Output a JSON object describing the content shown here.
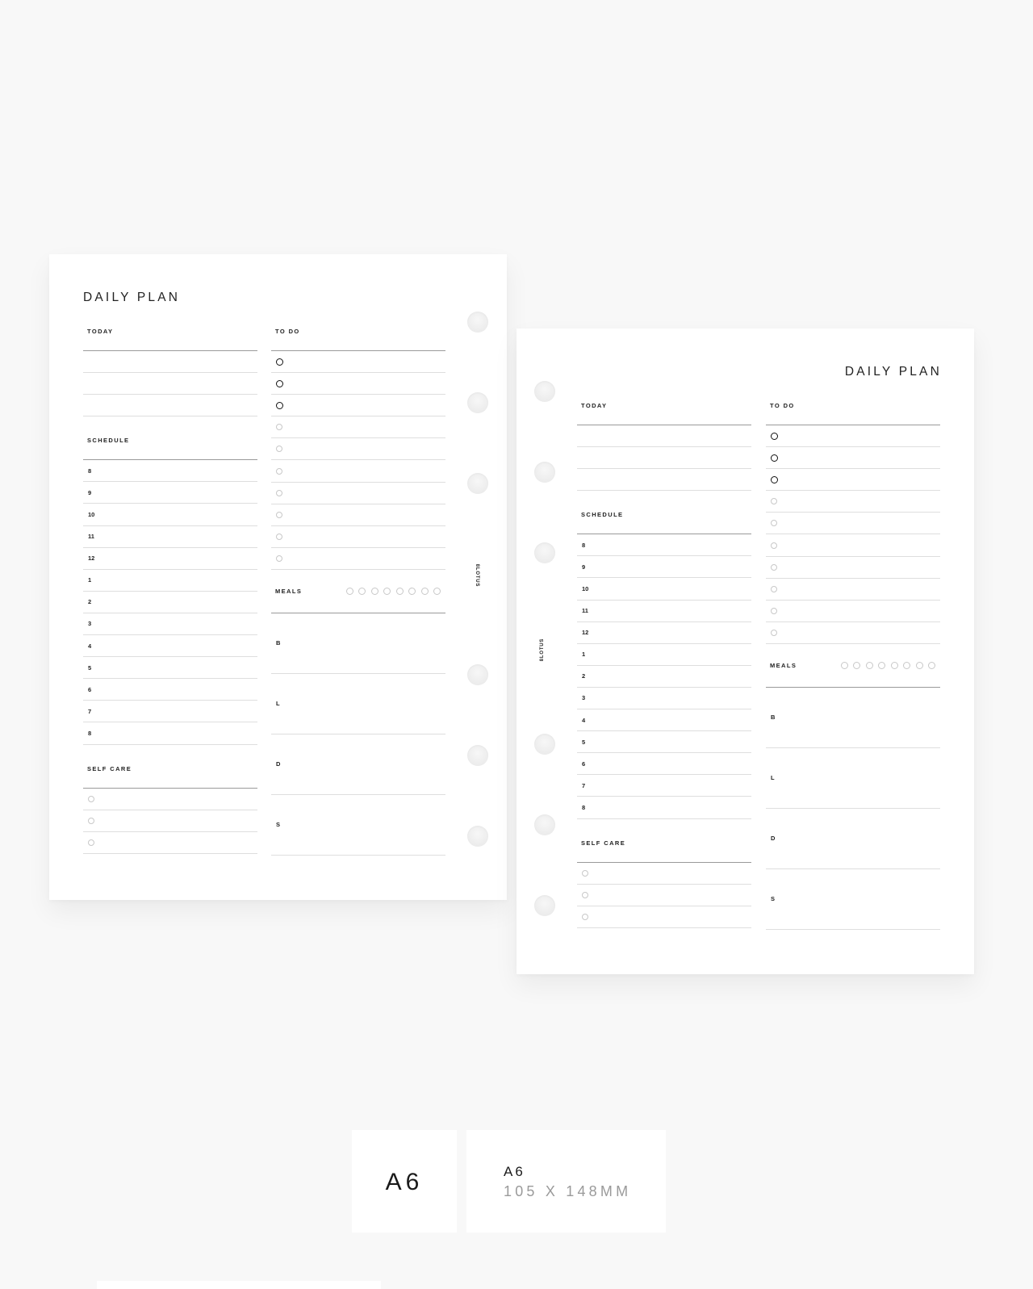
{
  "planner": {
    "title": "DAILY PLAN",
    "brand": "8LOTUS",
    "today": {
      "label": "TODAY",
      "line_count": 3
    },
    "todo": {
      "label": "TO DO",
      "priority_count": 3,
      "regular_count": 7
    },
    "schedule": {
      "label": "SCHEDULE",
      "hours": [
        "8",
        "9",
        "10",
        "11",
        "12",
        "1",
        "2",
        "3",
        "4",
        "5",
        "6",
        "7",
        "8"
      ]
    },
    "self_care": {
      "label": "SELF CARE",
      "item_count": 3
    },
    "meals": {
      "label": "MEALS",
      "water_count": 8,
      "rows": [
        "B",
        "L",
        "D",
        "S"
      ]
    }
  },
  "size_info": {
    "badge": "A6",
    "name": "A6",
    "dimensions": "105 X 148MM"
  }
}
